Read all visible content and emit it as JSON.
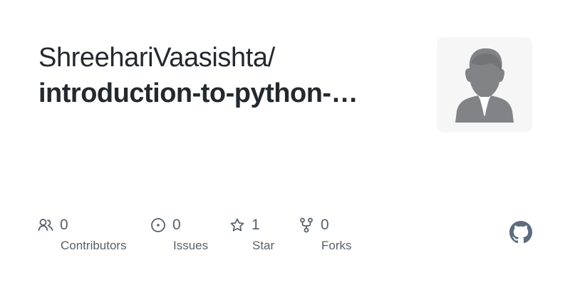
{
  "repository": {
    "owner": "ShreehariVaasishta/",
    "name": "introduction-to-python-…"
  },
  "stats": {
    "contributors": {
      "count": "0",
      "label": "Contributors",
      "icon": "people-icon"
    },
    "issues": {
      "count": "0",
      "label": "Issues",
      "icon": "issue-icon"
    },
    "stars": {
      "count": "1",
      "label": "Star",
      "icon": "star-icon"
    },
    "forks": {
      "count": "0",
      "label": "Forks",
      "icon": "fork-icon"
    }
  },
  "avatar": {
    "icon": "default-avatar-icon"
  },
  "brand": {
    "icon": "github-logo-icon"
  },
  "colors": {
    "text": "#24292f",
    "muted": "#57606a",
    "avatar_background": "#f6f6f6",
    "avatar_figure": "#818387",
    "logo": "#5c6c7e"
  }
}
